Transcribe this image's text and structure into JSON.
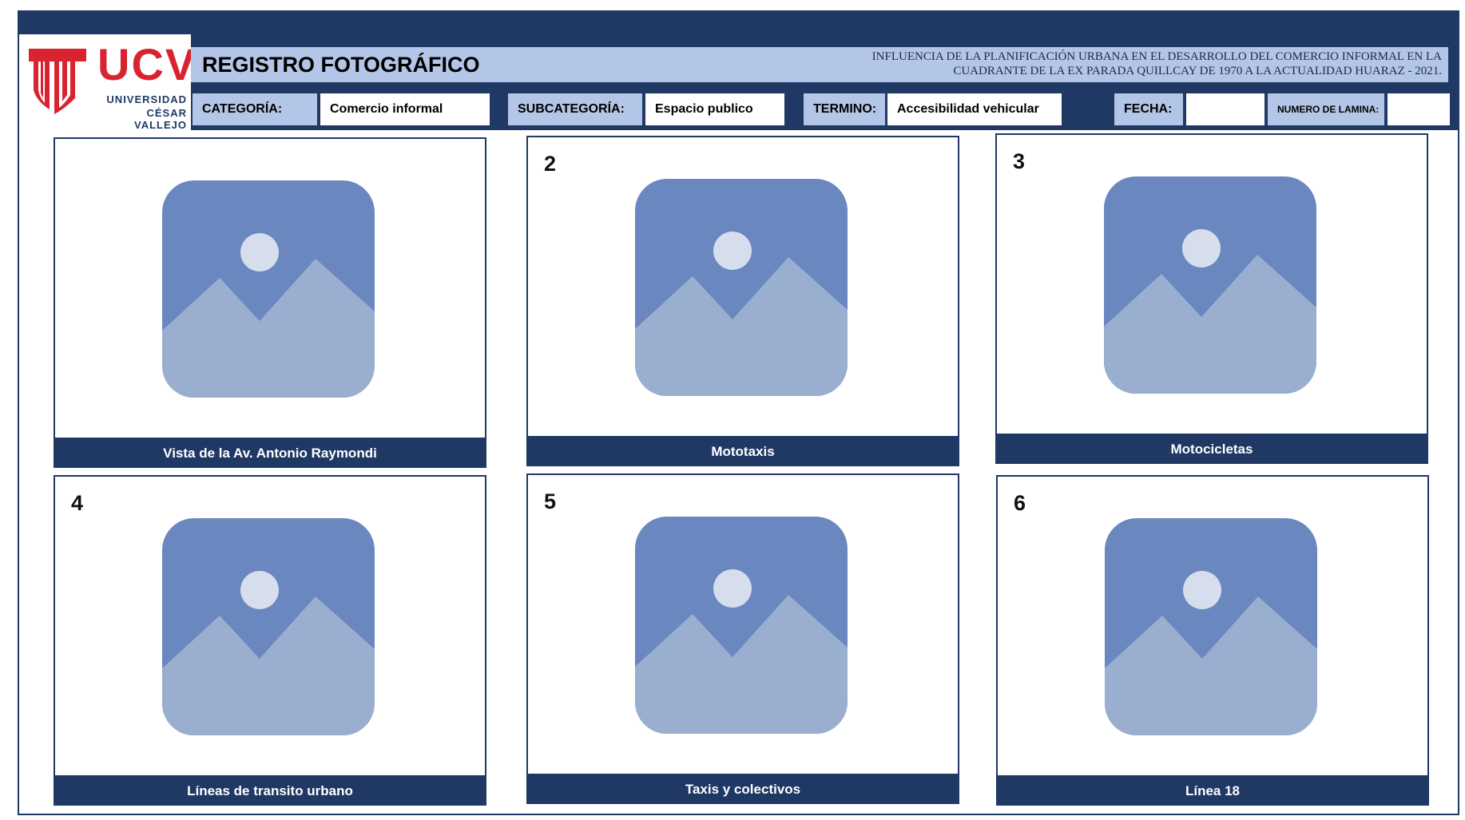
{
  "logo": {
    "brand": "UCV",
    "line1": "UNIVERSIDAD",
    "line2": "CÉSAR VALLEJO"
  },
  "header": {
    "title": "REGISTRO FOTOGRÁFICO",
    "subtitle_line1": "INFLUENCIA DE LA PLANIFICACIÓN URBANA EN EL DESARROLLO DEL COMERCIO INFORMAL EN LA",
    "subtitle_line2": "CUADRANTE DE LA EX PARADA QUILLCAY DE 1970 A LA ACTUALIDAD HUARAZ -  2021."
  },
  "fields": {
    "categoria_label": "CATEGORÍA:",
    "categoria_value": "Comercio informal",
    "subcategoria_label": "SUBCATEGORÍA:",
    "subcategoria_value": "Espacio publico",
    "termino_label": "TERMINO:",
    "termino_value": "Accesibilidad vehicular",
    "fecha_label": "FECHA:",
    "fecha_value": "",
    "lamina_label": "NUMERO DE LAMINA:",
    "lamina_value": ""
  },
  "colors": {
    "navy": "#1f3864",
    "light_blue": "#b4c6e7",
    "icon_dark": "#6a87bf",
    "icon_light": "#9aaed0",
    "brand_red": "#d9232e"
  },
  "photos": [
    {
      "number": "",
      "caption": "Vista de la Av. Antonio Raymondi",
      "icon": "image-placeholder-icon"
    },
    {
      "number": "2",
      "caption": "Mototaxis",
      "icon": "image-placeholder-icon"
    },
    {
      "number": "3",
      "caption": "Motocicletas",
      "icon": "image-placeholder-icon"
    },
    {
      "number": "4",
      "caption": "Líneas de transito urbano",
      "icon": "image-placeholder-icon"
    },
    {
      "number": "5",
      "caption": "Taxis y colectivos",
      "icon": "image-placeholder-icon"
    },
    {
      "number": "6",
      "caption": "Línea 18",
      "icon": "image-placeholder-icon"
    }
  ]
}
